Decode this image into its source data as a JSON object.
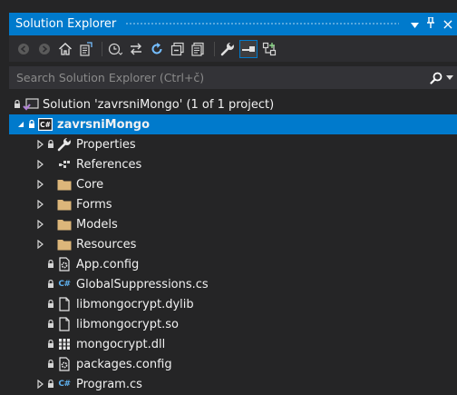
{
  "panel": {
    "title": "Solution Explorer",
    "pin_glyph": "↓",
    "autohide_glyph": "1",
    "close_glyph": "×"
  },
  "search": {
    "placeholder": "Search Solution Explorer (Ctrl+č)",
    "value": ""
  },
  "colors": {
    "accent": "#007acc",
    "background": "#252526",
    "folder": "#dcb67a",
    "csharp": "#5fb2f0"
  },
  "toolbar": {
    "icons": [
      "back-icon",
      "forward-icon",
      "home-icon",
      "switch-views-icon",
      "pending-changes-filter-icon",
      "sync-with-active-document-icon",
      "refresh-icon",
      "collapse-all-icon",
      "show-all-files-icon",
      "properties-icon",
      "preview-selected-items-icon",
      "class-view-icon"
    ]
  },
  "tree": {
    "solution": {
      "label": "Solution 'zavrsniMongo' (1 of 1 project)",
      "icon": "solution-icon"
    },
    "project": {
      "label": "zavrsniMongo",
      "icon": "csharp-project-icon",
      "selected": true
    },
    "items": [
      {
        "label": "Properties",
        "icon": "wrench-icon",
        "expandable": true,
        "locked": true
      },
      {
        "label": "References",
        "icon": "references-icon",
        "expandable": true,
        "locked": false
      },
      {
        "label": "Core",
        "icon": "folder-icon",
        "expandable": true,
        "locked": false
      },
      {
        "label": "Forms",
        "icon": "folder-icon",
        "expandable": true,
        "locked": false
      },
      {
        "label": "Models",
        "icon": "folder-icon",
        "expandable": true,
        "locked": false
      },
      {
        "label": "Resources",
        "icon": "folder-icon",
        "expandable": true,
        "locked": false
      },
      {
        "label": "App.config",
        "icon": "config-file-icon",
        "expandable": false,
        "locked": true
      },
      {
        "label": "GlobalSuppressions.cs",
        "icon": "csharp-file-icon",
        "expandable": false,
        "locked": true
      },
      {
        "label": "libmongocrypt.dylib",
        "icon": "file-icon",
        "expandable": false,
        "locked": true
      },
      {
        "label": "libmongocrypt.so",
        "icon": "file-icon",
        "expandable": false,
        "locked": true
      },
      {
        "label": "mongocrypt.dll",
        "icon": "dll-icon",
        "expandable": false,
        "locked": true
      },
      {
        "label": "packages.config",
        "icon": "config-file-icon",
        "expandable": false,
        "locked": true
      },
      {
        "label": "Program.cs",
        "icon": "csharp-file-icon",
        "expandable": true,
        "locked": true
      }
    ]
  }
}
